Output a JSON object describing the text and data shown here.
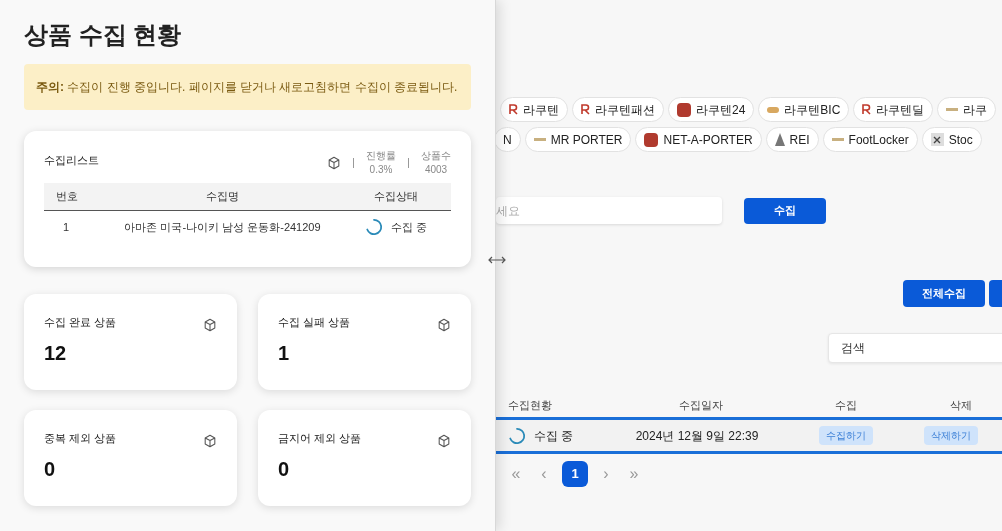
{
  "panel": {
    "title": "상품 수집 현황",
    "notice": "**주의:** 수집이 진행 중입니다. 페이지를 닫거나 새로고침하면 수집이 종료됩니다.",
    "list_card": {
      "title": "수집리스트",
      "progress_label": "진행률",
      "progress_value": "0.3%",
      "count_label": "상품수",
      "count_value": "4003",
      "columns": [
        "번호",
        "수집명",
        "수집상태"
      ],
      "rows": [
        {
          "cells": [
            "1",
            "아마존 미국-나이키 남성 운동화-241209"
          ],
          "status": "수집 중",
          "loading": true
        }
      ]
    },
    "stats": [
      {
        "label": "수집 완료 상품",
        "value": "12"
      },
      {
        "label": "수집 실패 상품",
        "value": "1"
      },
      {
        "label": "중복 제외 상품",
        "value": "0"
      },
      {
        "label": "금지어 제외 상품",
        "value": "0"
      }
    ]
  },
  "page": {
    "store_rows": [
      [
        {
          "label": "라쿠텐",
          "kind": "r"
        },
        {
          "label": "라쿠텐패션",
          "kind": "r"
        },
        {
          "label": "라쿠텐24",
          "kind": "box"
        },
        {
          "label": "라쿠텐BIC",
          "kind": "small"
        },
        {
          "label": "라쿠텐딜",
          "kind": "r"
        },
        {
          "label": "라쿠",
          "kind": "dash"
        }
      ],
      [
        {
          "label": "N"
        },
        {
          "label": "MR PORTER",
          "kind": "dash"
        },
        {
          "label": "NET-A-PORTER",
          "kind": "box"
        },
        {
          "label": "REI",
          "kind": "peak"
        },
        {
          "label": "FootLocker",
          "kind": "dash"
        },
        {
          "label": "Stoc",
          "kind": "x"
        }
      ]
    ],
    "url_field": {
      "placeholder": "세요"
    },
    "collect_button": "수집",
    "collect_all_button": "전체수집",
    "search_field": {
      "placeholder": "검색"
    },
    "table": {
      "columns": [
        "수집현황",
        "수집일자",
        "수집",
        "삭제"
      ],
      "rows": [
        {
          "status": "수집 중",
          "loading": true,
          "date": "2024년 12월 9일 22:39",
          "collect": "수집하기",
          "delete": "삭제하기"
        }
      ]
    },
    "pagination": {
      "first": "«",
      "prev": "‹",
      "pages": [
        {
          "label": "1",
          "selected": true
        }
      ],
      "next": "›",
      "last": "»"
    }
  }
}
